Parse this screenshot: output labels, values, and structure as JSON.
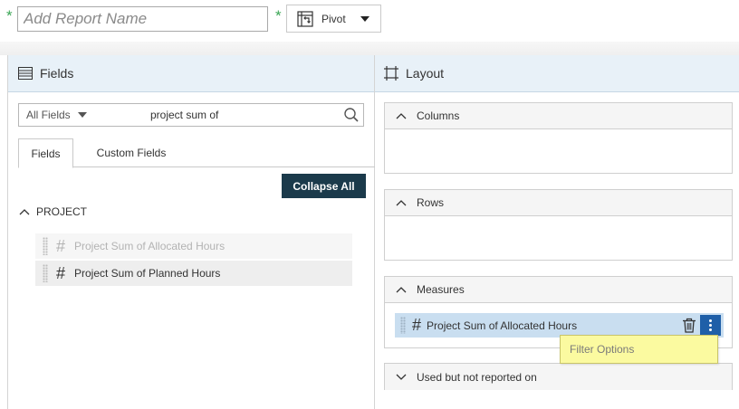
{
  "header": {
    "report_name_placeholder": "Add Report Name",
    "report_name_value": "",
    "required_mark": "*",
    "view_type": "Pivot"
  },
  "fields_panel": {
    "title": "Fields",
    "search": {
      "scope": "All Fields",
      "value": "project sum of"
    },
    "tabs": [
      {
        "label": "Fields",
        "active": true
      },
      {
        "label": "Custom Fields",
        "active": false
      }
    ],
    "collapse_all_label": "Collapse All",
    "groups": [
      {
        "label": "PROJECT",
        "items": [
          {
            "label": "Project Sum of Allocated Hours",
            "state": "disabled"
          },
          {
            "label": "Project Sum of Planned Hours",
            "state": "enabled"
          }
        ]
      }
    ]
  },
  "layout_panel": {
    "title": "Layout",
    "zones": {
      "columns": "Columns",
      "rows": "Rows",
      "measures": "Measures",
      "unused": "Used but not reported on"
    },
    "measures_items": [
      {
        "label": "Project Sum of Allocated Hours"
      }
    ]
  },
  "tooltip": {
    "text": "Filter Options"
  },
  "colors": {
    "required": "#3aa655",
    "panel_header_bg": "#e8f1f8",
    "primary_dark": "#1b3a4b",
    "measure_item_bg": "#c9def0",
    "kebab_bg": "#1f5fa8",
    "tooltip_bg": "#fbfaa0"
  },
  "icons": {
    "fields_header": "list-icon",
    "layout_header": "layout-icon",
    "pivot": "pivot-icon",
    "search": "search-icon",
    "numeric_field": "hash-icon",
    "delete": "trash-icon",
    "more": "kebab-icon",
    "expand": "chevron-up-icon",
    "collapse": "chevron-down-icon"
  }
}
